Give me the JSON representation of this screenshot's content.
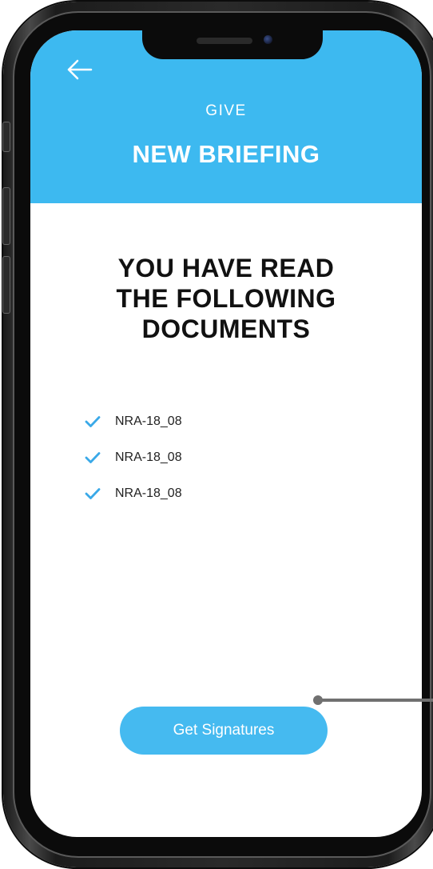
{
  "header": {
    "back_icon": "arrow-left-icon",
    "eyebrow": "GIVE",
    "title": "NEW BRIEFING"
  },
  "main": {
    "heading_lines": [
      "YOU HAVE READ",
      "THE FOLLOWING",
      "DOCUMENTS"
    ],
    "documents": [
      {
        "label": "NRA-18_08",
        "icon": "check-icon"
      },
      {
        "label": "NRA-18_08",
        "icon": "check-icon"
      },
      {
        "label": "NRA-18_08",
        "icon": "check-icon"
      }
    ],
    "cta_label": "Get Signatures"
  },
  "colors": {
    "accent": "#3db9f0",
    "button": "#45baf0",
    "check": "#3aa9e8",
    "text_dark": "#111111",
    "callout": "#707070"
  }
}
